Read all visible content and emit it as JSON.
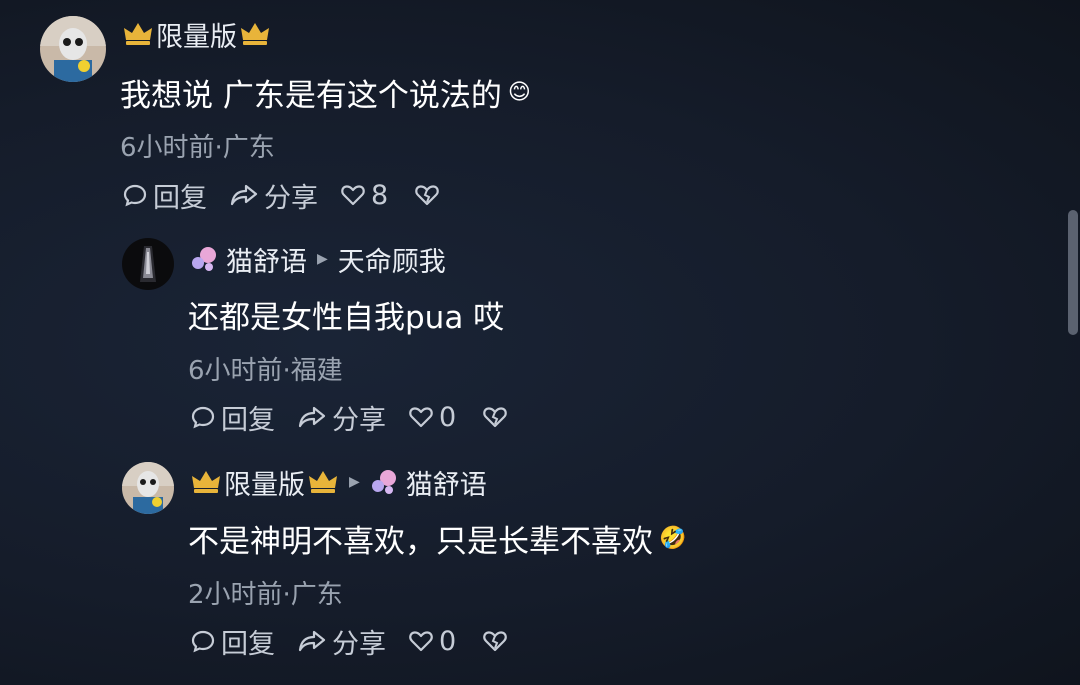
{
  "comments": [
    {
      "username": "限量版",
      "text": "我想说 广东是有这个说法的",
      "emoji": "😊",
      "meta": "6小时前·广东",
      "reply_label": "回复",
      "share_label": "分享",
      "likes": "8"
    },
    {
      "username": "猫舒语",
      "reply_to": "天命顾我",
      "text": "还都是女性自我pua 哎",
      "meta": "6小时前·福建",
      "reply_label": "回复",
      "share_label": "分享",
      "likes": "0"
    },
    {
      "username": "限量版",
      "reply_to": "猫舒语",
      "text": "不是神明不喜欢，只是长辈不喜欢",
      "emoji": "🤣",
      "meta": "2小时前·广东",
      "reply_label": "回复",
      "share_label": "分享",
      "likes": "0"
    }
  ],
  "colors": {
    "background": "#151c2a",
    "crown": "#e8b43a",
    "bubble_pink": "#e9a7d8",
    "bubble_blue": "#b9a7f0",
    "meta_text": "#9aa3b0"
  },
  "icons": [
    "crown-icon",
    "bubble-icon",
    "reply-icon",
    "share-icon",
    "heart-icon",
    "broken-heart-icon",
    "caret-right-icon"
  ]
}
